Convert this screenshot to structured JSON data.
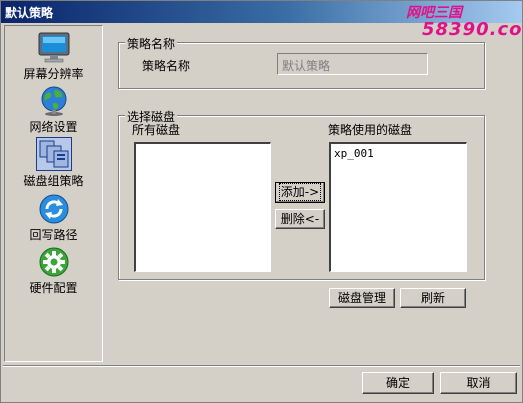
{
  "window": {
    "title": "默认策略"
  },
  "watermark": {
    "line1": "网吧三国",
    "line2": "58390.com"
  },
  "sidebar": {
    "items": [
      {
        "label": "屏幕分辨率",
        "icon": "monitor-icon"
      },
      {
        "label": "网络设置",
        "icon": "globe-icon"
      },
      {
        "label": "磁盘组策略",
        "icon": "disk-group-icon"
      },
      {
        "label": "回写路径",
        "icon": "refresh-icon"
      },
      {
        "label": "硬件配置",
        "icon": "gear-icon"
      }
    ]
  },
  "policy_name_group": {
    "title": "策略名称",
    "field_label": "策略名称",
    "field_value": "默认策略"
  },
  "disk_select_group": {
    "title": "选择磁盘",
    "all_disks_label": "所有磁盘",
    "used_disks_label": "策略使用的磁盘",
    "all_disks": [],
    "used_disks": [
      "xp_001"
    ],
    "add_button": "添加->",
    "remove_button": "删除<-"
  },
  "actions": {
    "disk_manage": "磁盘管理",
    "refresh": "刷新",
    "ok": "确定",
    "cancel": "取消"
  },
  "colors": {
    "face": "#d4d0c8",
    "titlebar_start": "#0a246a",
    "titlebar_end": "#a6caf0",
    "watermark": "#e0128a"
  }
}
